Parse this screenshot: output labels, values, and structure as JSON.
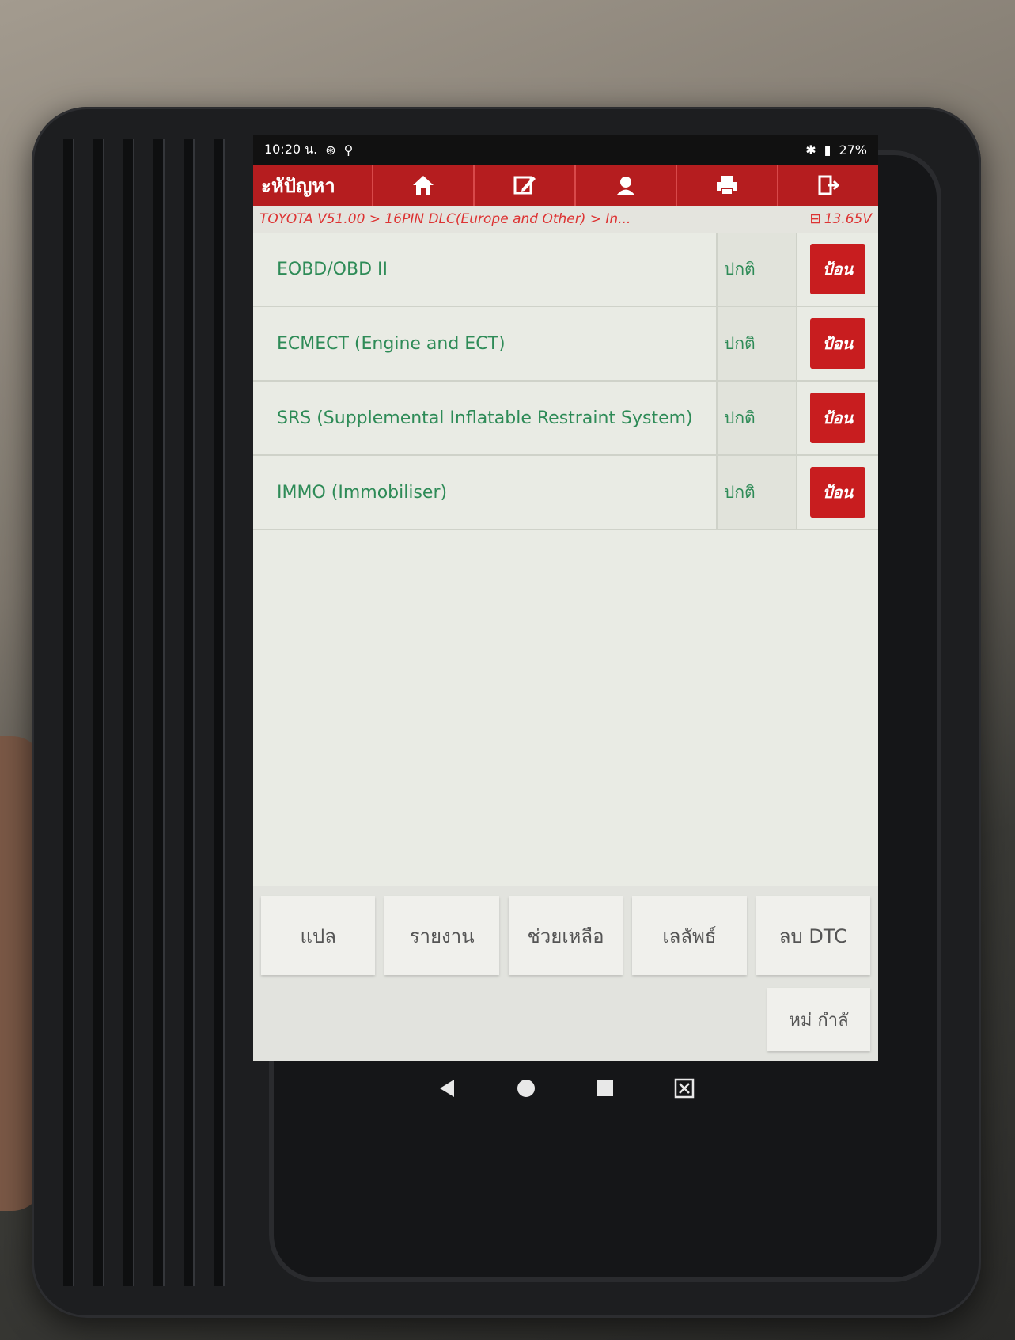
{
  "status_bar": {
    "time": "10:20 น.",
    "battery": "27%"
  },
  "toolbar": {
    "title": "ะหัปัญหา",
    "icons": [
      "home-icon",
      "edit-icon",
      "user-icon",
      "print-icon",
      "exit-icon"
    ]
  },
  "breadcrumb": {
    "path": "TOYOTA V51.00 > 16PIN DLC(Europe and Other) > In...",
    "voltage": "13.65V"
  },
  "systems": [
    {
      "name": "EOBD/OBD II",
      "status": "ปกติ",
      "action": "ป้อน"
    },
    {
      "name": "ECMECT (Engine and ECT)",
      "status": "ปกติ",
      "action": "ป้อน"
    },
    {
      "name": "SRS (Supplemental Inflatable Restraint System)",
      "status": "ปกติ",
      "action": "ป้อน"
    },
    {
      "name": "IMMO (Immobiliser)",
      "status": "ปกติ",
      "action": "ป้อน"
    }
  ],
  "function_buttons": [
    "แปล",
    "รายงาน",
    "ช่วยเหลือ",
    "เลลัพธ์",
    "ลบ DTC"
  ],
  "next_button": "หม่ กำลั",
  "colors": {
    "toolbar": "#b51d1f",
    "accent_text": "#2e8b57",
    "enter_button": "#c81d1f"
  }
}
